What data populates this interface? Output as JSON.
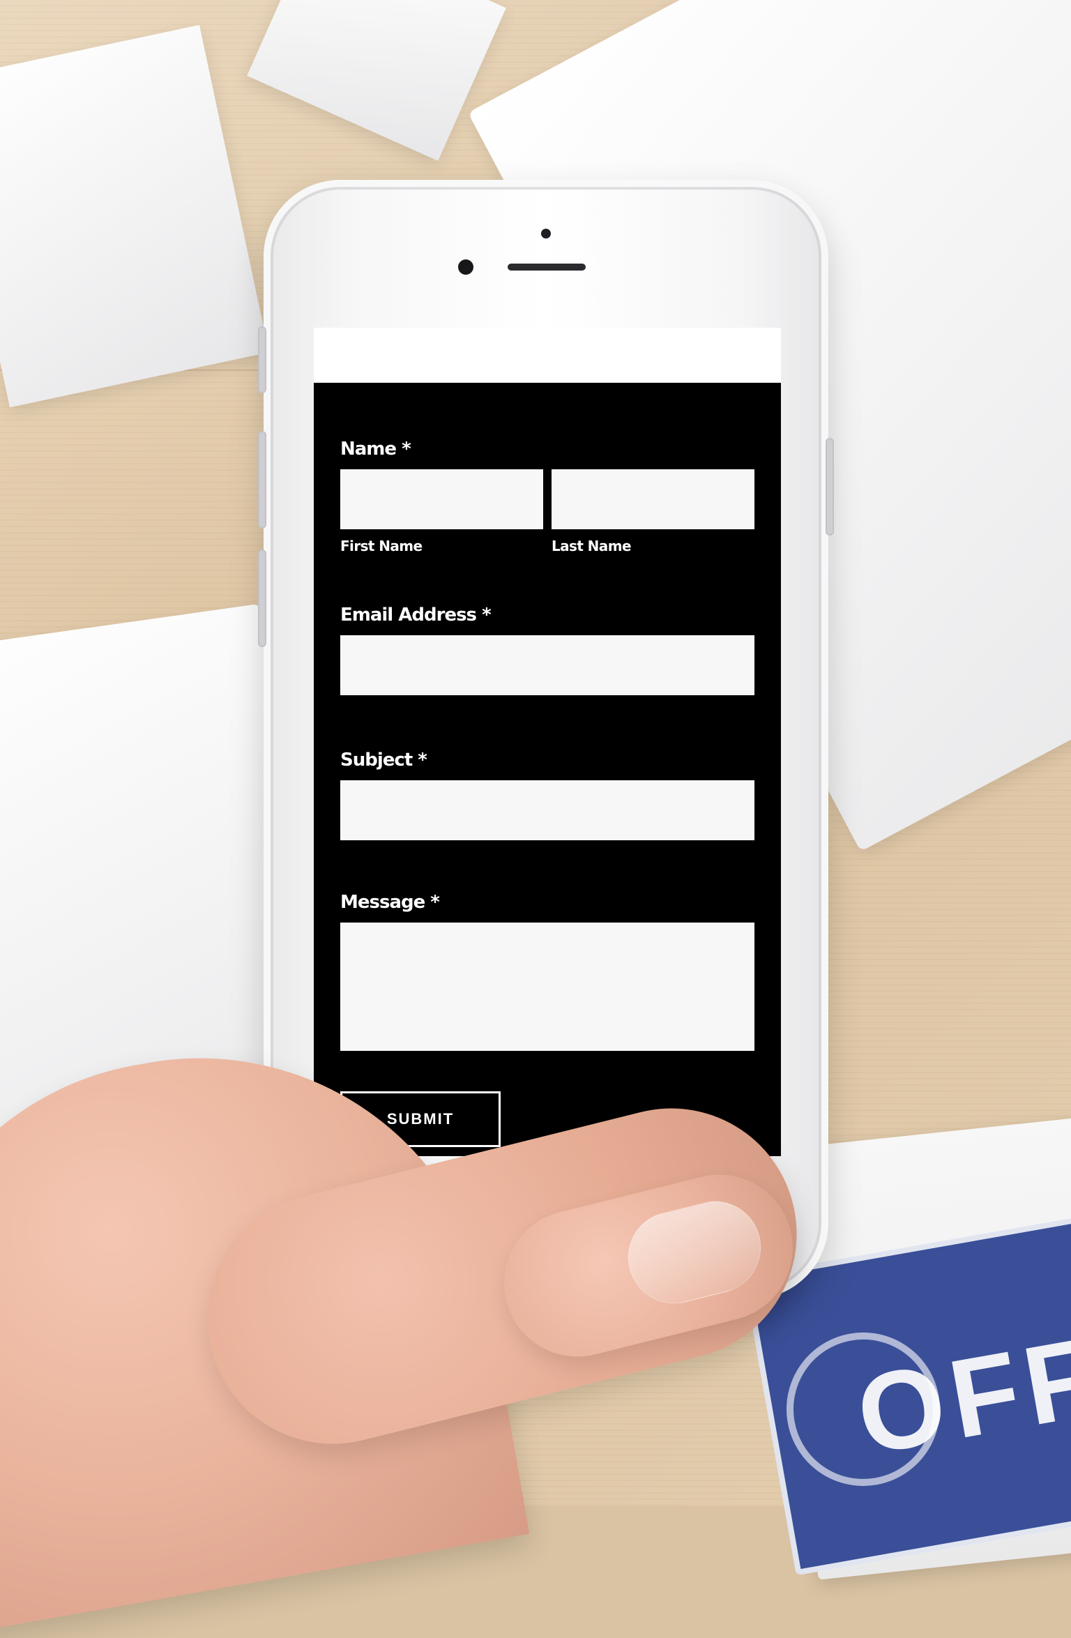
{
  "label": {
    "text": "OFFI"
  },
  "form": {
    "name_label": "Name *",
    "first_name_label": "First Name",
    "last_name_label": "Last Name",
    "email_label": "Email Address *",
    "subject_label": "Subject *",
    "message_label": "Message *",
    "submit_label": "SUBMIT"
  }
}
